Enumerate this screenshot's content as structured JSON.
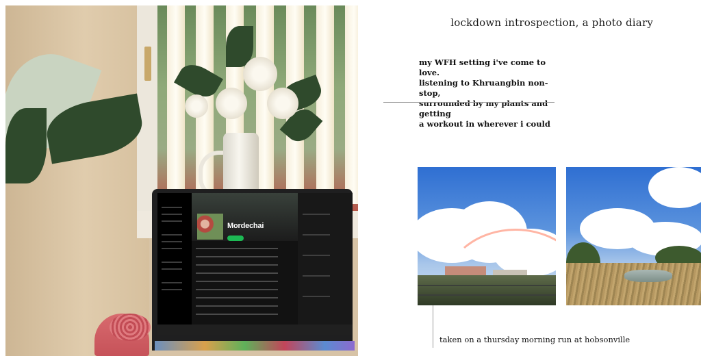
{
  "page": {
    "title": "lockdown introspection, a photo diary",
    "intro": "my WFH setting i've come to love.\nlistening to Khruangbin non-stop,\nsurrounded by my plants and getting\na workout in wherever i could",
    "caption": "taken on a thursday morning run at hobsonville"
  },
  "photos": {
    "main": {
      "laptop_screen": {
        "album_title": "Mordechai"
      }
    }
  },
  "colors": {
    "page_background": "#ffffff",
    "text": "#111111",
    "rule": "#9a9a9a",
    "spotify_green": "#1db954",
    "sky_blue": "#2f6fd2"
  }
}
